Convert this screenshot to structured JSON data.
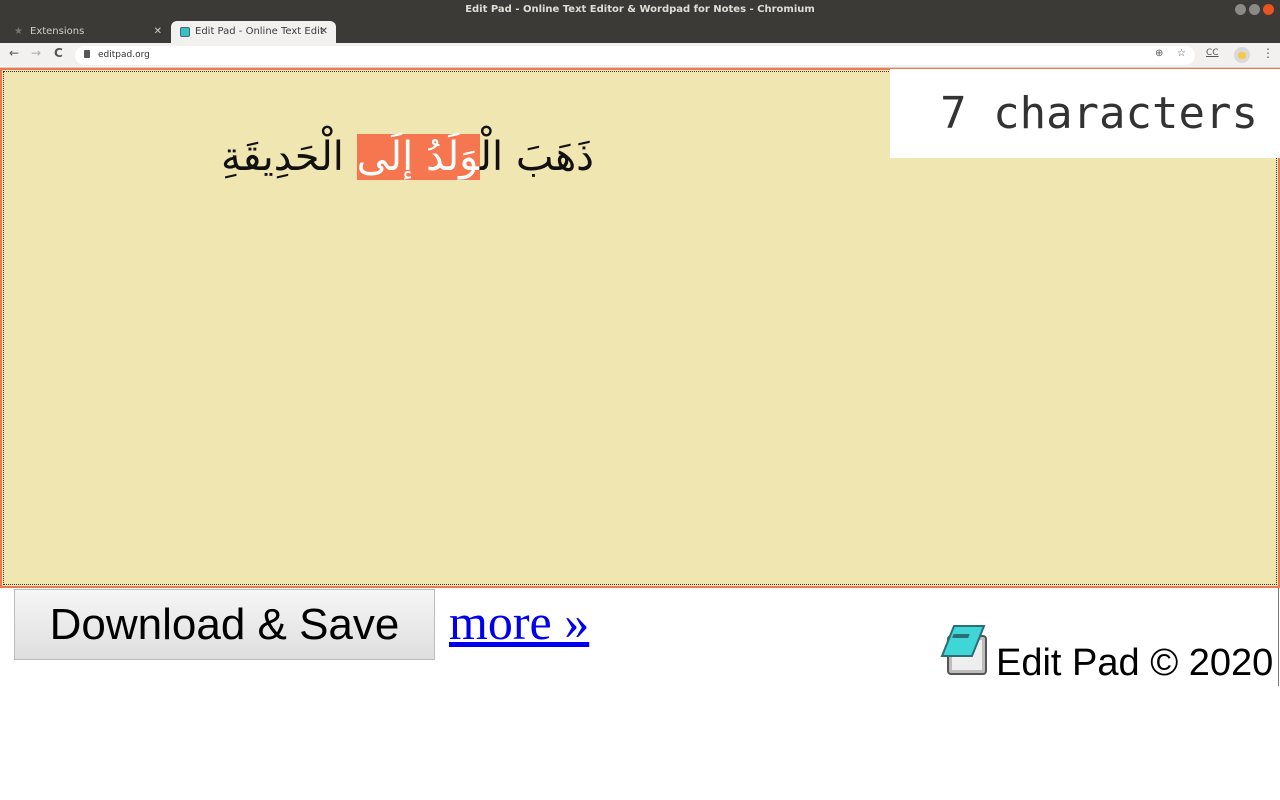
{
  "window": {
    "title": "Edit Pad - Online Text Editor & Wordpad for Notes - Chromium"
  },
  "tabs": [
    {
      "label": "Extensions",
      "icon": "puzzle-icon",
      "active": false
    },
    {
      "label": "Edit Pad - Online Text Edit",
      "icon": "editpad-favicon",
      "active": true
    }
  ],
  "toolbar": {
    "back": "←",
    "forward": "→",
    "reload": "C",
    "url": "editpad.org",
    "zoom_icon": "⊕",
    "star_icon": "☆",
    "cc_label": "CC",
    "menu_icon": "⋮"
  },
  "editor": {
    "text_before": "ذَهَبَ الْ",
    "text_selected": "وَلَدُ إلَى",
    "text_after": " الْحَدِيقَةِ",
    "background": "#f0e6b2",
    "selection_color": "#f5764f"
  },
  "counter": {
    "label": "7 characters"
  },
  "actions": {
    "download_label": "Download & Save",
    "more_label": "more »"
  },
  "footer": {
    "text": "Edit Pad © 2020"
  }
}
